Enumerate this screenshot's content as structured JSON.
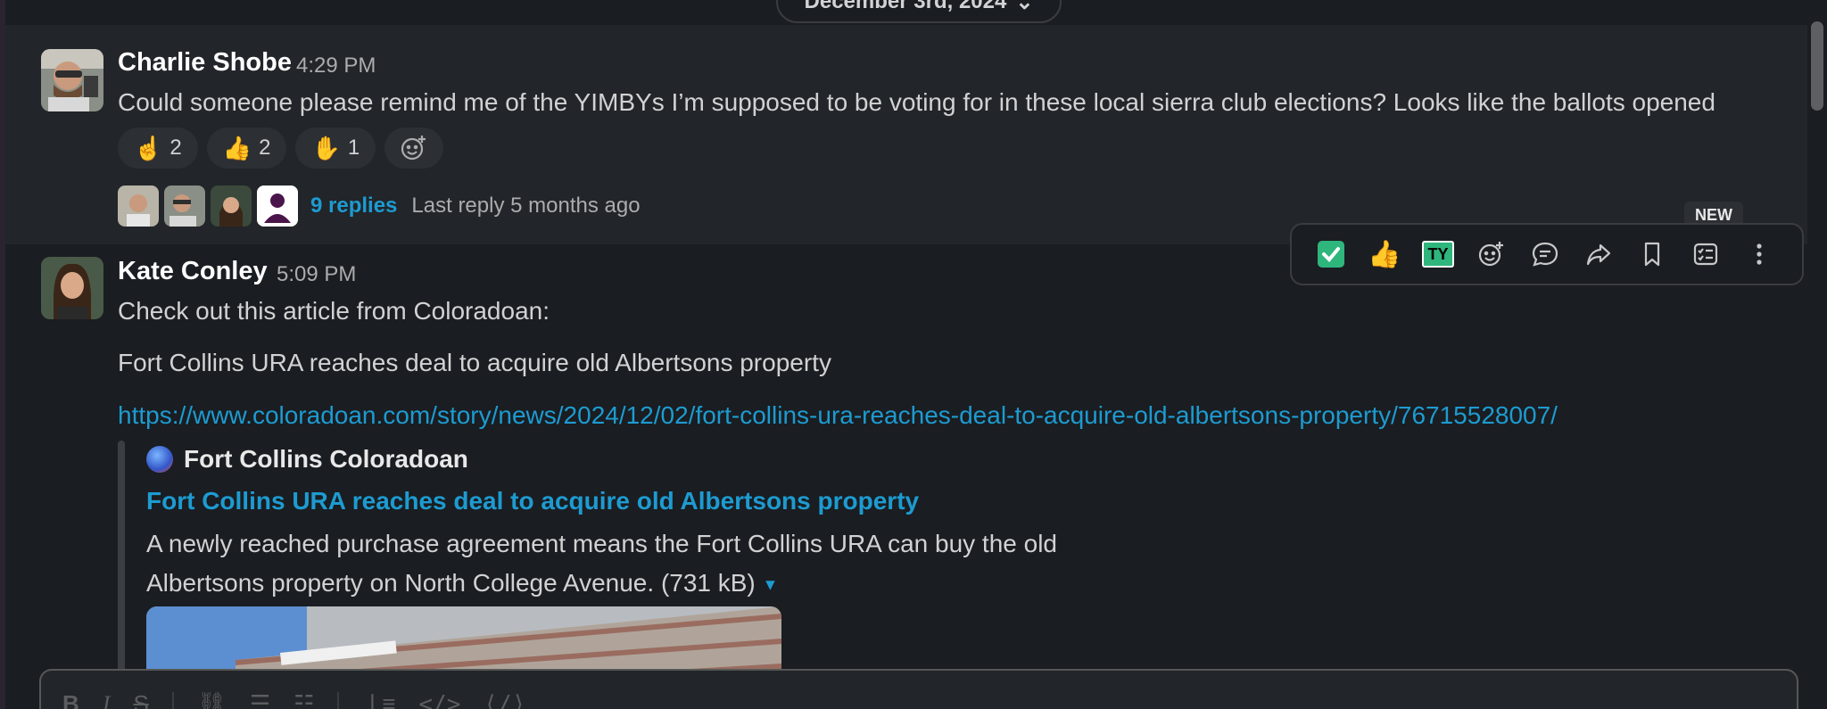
{
  "date_divider": {
    "label": "December 3rd, 2024"
  },
  "messages": [
    {
      "author": "Charlie Shobe",
      "time": "4:29 PM",
      "text": "Could someone please remind me of the YIMBYs I’m supposed to be voting for in these local sierra club elections? Looks like the ballots opened",
      "reactions": [
        {
          "emoji": "☝️",
          "count": "2"
        },
        {
          "emoji": "👍",
          "count": "2"
        },
        {
          "emoji": "✋",
          "count": "1"
        }
      ],
      "thread": {
        "replies": "9 replies",
        "last_reply": "Last reply 5 months ago"
      }
    },
    {
      "author": "Kate Conley",
      "time": "5:09 PM",
      "line1": "Check out this article from Coloradoan:",
      "line2": "Fort Collins URA reaches deal to acquire old Albertsons property",
      "url": "https://www.coloradoan.com/story/news/2024/12/02/fort-collins-ura-reaches-deal-to-acquire-old-albertsons-property/76715528007/",
      "attachment": {
        "site": "Fort Collins Coloradoan",
        "title": "Fort Collins URA reaches deal to acquire old Albertsons property",
        "desc_line1": "A newly reached purchase agreement means the Fort Collins URA can buy the old",
        "desc_line2": "Albertsons property on North College Avenue. (731 kB)"
      }
    }
  ],
  "toolbar": {
    "new_badge": "NEW",
    "ty_label": "TY",
    "icons": [
      "check-mark-icon",
      "thumbs-up-icon",
      "ty-icon",
      "add-reaction-icon",
      "reply-thread-icon",
      "share-icon",
      "bookmark-icon",
      "list-checklist-icon",
      "more-actions-icon"
    ]
  },
  "composer": {
    "format_icons": [
      "bold-icon",
      "italic-icon",
      "strikethrough-icon",
      "link-icon",
      "numbered-list-icon",
      "bulleted-list-icon",
      "blockquote-icon",
      "code-icon",
      "code-block-icon"
    ]
  },
  "colors": {
    "background": "#1a1d21",
    "hover_background": "#222529",
    "link": "#1d9bd1",
    "text": "#d1d2d3"
  }
}
